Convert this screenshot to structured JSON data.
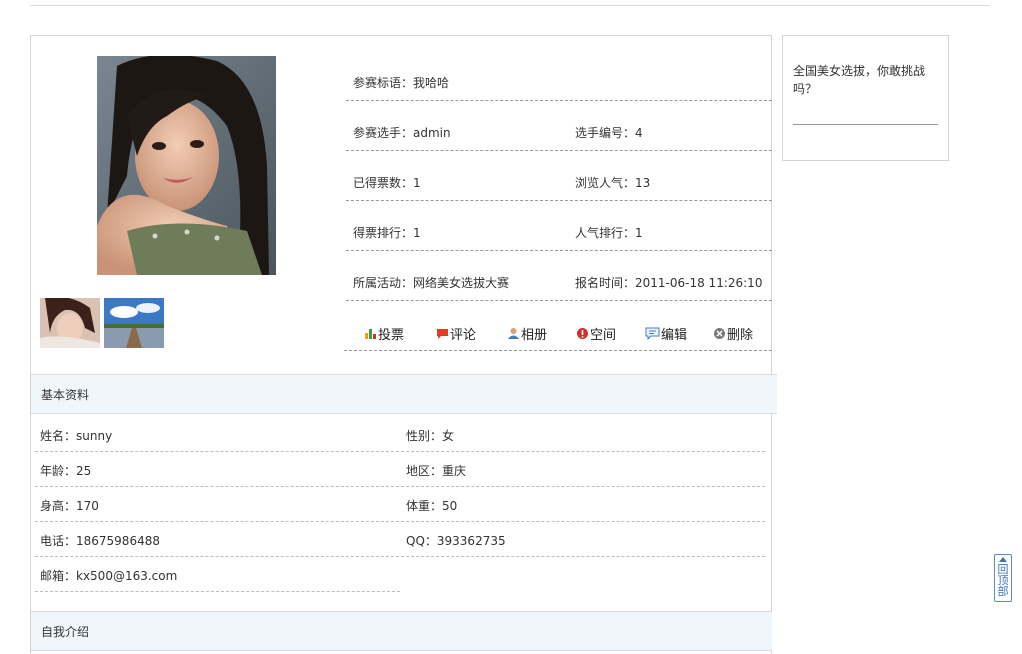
{
  "contestant": {
    "slogan": "参赛标语：我哈哈",
    "name": "参赛选手：admin",
    "number": "选手编号：4",
    "votes": "已得票数：1",
    "views": "浏览人气：13",
    "vote_rank": "得票排行：1",
    "pop_rank": "人气排行：1",
    "activity": "所属活动：网络美女选拔大赛",
    "signup_time": "报名时间：2011-06-18 11:26:10"
  },
  "actions": [
    {
      "label": "投票",
      "icon": "bar-chart-icon"
    },
    {
      "label": "评论",
      "icon": "comment-icon"
    },
    {
      "label": "相册",
      "icon": "user-icon"
    },
    {
      "label": "空间",
      "icon": "alert-icon"
    },
    {
      "label": "编辑",
      "icon": "edit-bubble-icon"
    },
    {
      "label": "删除",
      "icon": "delete-icon"
    }
  ],
  "basic": {
    "title": "基本资料",
    "name": "姓名：sunny",
    "gender": "性别：女",
    "age": "年龄：25",
    "region": "地区：重庆",
    "height": "身高：170",
    "weight": "体重：50",
    "phone": "电话：18675986488",
    "qq": "QQ：393362735",
    "email": "邮箱：kx500@163.com"
  },
  "intro": {
    "title": "自我介绍"
  },
  "sidebar": {
    "text": "全国美女选拔，你敢挑战吗？"
  },
  "back_to_top": {
    "chars": [
      "回",
      "顶",
      "部"
    ]
  },
  "colors": {
    "section_bg": "#f0f7fc",
    "border": "#d4d4d4",
    "accent_blue": "#3b74b4"
  }
}
